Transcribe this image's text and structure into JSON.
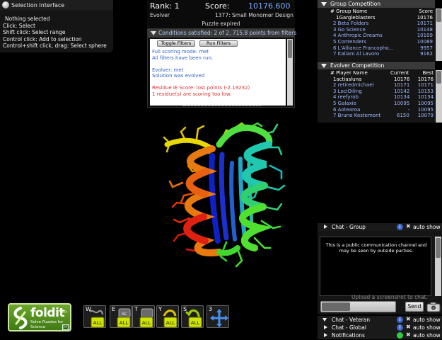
{
  "selection": {
    "title": "Selection Interface",
    "lines": [
      "Nothing selected",
      "Click: Select",
      "Shift click: Select range",
      "Control click: Add to selection",
      "Control+shift click, drag: Select sphere"
    ]
  },
  "score_panel": {
    "rank": "Rank: 1",
    "score_label": "Score:",
    "score_value": "10176.600",
    "mode": "Evolver",
    "puzzle": "1377: Small Monomer Design",
    "status": "Puzzle expired"
  },
  "conditions": {
    "header": "Conditions satisfied: 2 of 2, 715.8 points from filters",
    "toggle_label": "Toggle Filters",
    "run_label": "Run Filters",
    "line1": "Full scoring mode: met",
    "line2": "All filters have been run.",
    "line3": "Evolver: met",
    "line4": "Solution was evolved",
    "line5": "Residue IE Score: lost points (-2.19232)",
    "line6": "1 residue(s) are scoring too low."
  },
  "group_competition": {
    "title": "Group Competition",
    "col_name": "# Group Name",
    "col_score": "Score",
    "rows": [
      {
        "name": "1Gargleblasters",
        "score": "10176"
      },
      {
        "name": "2 Beta Folders",
        "score": "10171"
      },
      {
        "name": "3 Go Science",
        "score": "10148"
      },
      {
        "name": "4 Anthropic Dreams",
        "score": "10109"
      },
      {
        "name": "5 Contenders",
        "score": "10089"
      },
      {
        "name": "6 L'Alliance Francopho...",
        "score": "9957"
      },
      {
        "name": "7 Italiani Al Lavoro",
        "score": "9162"
      }
    ]
  },
  "evolver_competition": {
    "title": "Evolver Competition",
    "col_name": "# Player Name",
    "col_current": "Current",
    "col_best": "Best",
    "rows": [
      {
        "name": "1actiasluna",
        "current": "10176",
        "best": "10176"
      },
      {
        "name": "2 retiredmichael",
        "current": "10171",
        "best": "10171"
      },
      {
        "name": "3 LociOiling",
        "current": "10142",
        "best": "10153"
      },
      {
        "name": "4 reefyrob",
        "current": "10134",
        "best": "10134"
      },
      {
        "name": "5 Galaxie",
        "current": "10095",
        "best": "10095"
      },
      {
        "name": "6 Aotearoa",
        "current": "-",
        "best": "10095"
      },
      {
        "name": "7 Bruno Kestemont",
        "current": "6150",
        "best": "10079"
      }
    ]
  },
  "chat": {
    "group_label": "Chat - Group",
    "veteran_label": "Chat - Veteran",
    "global_label": "Chat - Global",
    "notifications_label": "Notifications",
    "auto_show": "auto show",
    "info_glyph": "i",
    "notice_line1": "This is a public communication channel and",
    "notice_line2": "may be seen by outside parties.",
    "upload_text": "Upload a screenshot to chat.",
    "send_label": "Send"
  },
  "logo": {
    "name": "foldit",
    "beta": "BETA",
    "tagline": "Solve Puzzles for Science",
    "help": "[H]"
  },
  "toolbar": [
    {
      "key": "W",
      "icon": "wiggle-all-icon",
      "badge": "ALL"
    },
    {
      "key": "E",
      "icon": "shake-sidechains-all-icon",
      "badge": "ALL"
    },
    {
      "key": "T",
      "icon": "wiggle-sidechains-all-icon",
      "badge": "ALL"
    },
    {
      "key": "Y",
      "icon": "rebuild-all-icon",
      "badge": "ALL"
    },
    {
      "key": "S",
      "icon": "undo-all-icon",
      "badge": "ALL"
    },
    {
      "key": "3",
      "icon": "move-pan-icon",
      "badge": ""
    }
  ],
  "colors": {
    "score_blue": "#7aa9ff",
    "link_blue": "#9fb8ff",
    "warning_red": "#e03030",
    "logo_green": "#5a9420"
  }
}
